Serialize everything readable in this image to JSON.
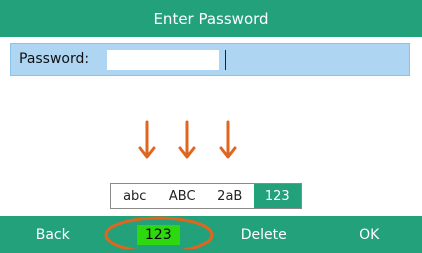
{
  "title": "Enter Password",
  "password_field": {
    "label": "Password:",
    "value": ""
  },
  "input_modes": {
    "options": [
      "abc",
      "ABC",
      "2aB",
      "123"
    ],
    "selected": "123"
  },
  "softkeys": {
    "back": "Back",
    "mode": "123",
    "delete": "Delete",
    "ok": "OK"
  },
  "colors": {
    "header": "#22a17a",
    "field_background": "#aed6f2",
    "mode_highlight": "#2ed80e",
    "annotation": "#e0661f"
  }
}
